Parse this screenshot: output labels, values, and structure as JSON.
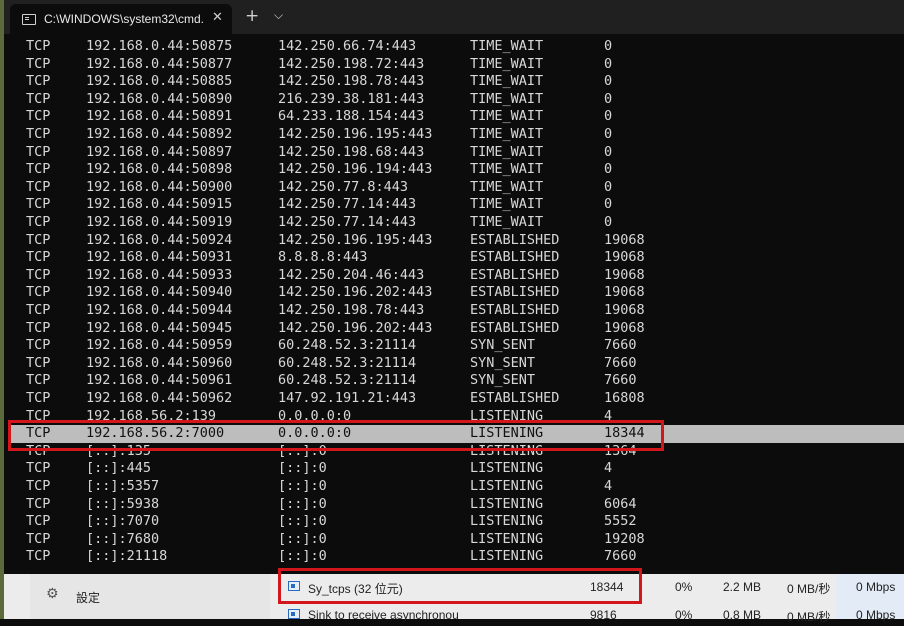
{
  "window": {
    "tab_title": "C:\\WINDOWS\\system32\\cmd.",
    "tab_icon": "terminal-icon",
    "close_glyph": "✕",
    "new_tab_glyph": "+",
    "dropdown_glyph": "⌵"
  },
  "netstat": {
    "rows": [
      {
        "proto": "TCP",
        "local": "192.168.0.44:50875",
        "foreign": "142.250.66.74:443",
        "state": "TIME_WAIT",
        "pid": "0"
      },
      {
        "proto": "TCP",
        "local": "192.168.0.44:50877",
        "foreign": "142.250.198.72:443",
        "state": "TIME_WAIT",
        "pid": "0"
      },
      {
        "proto": "TCP",
        "local": "192.168.0.44:50885",
        "foreign": "142.250.198.78:443",
        "state": "TIME_WAIT",
        "pid": "0"
      },
      {
        "proto": "TCP",
        "local": "192.168.0.44:50890",
        "foreign": "216.239.38.181:443",
        "state": "TIME_WAIT",
        "pid": "0"
      },
      {
        "proto": "TCP",
        "local": "192.168.0.44:50891",
        "foreign": "64.233.188.154:443",
        "state": "TIME_WAIT",
        "pid": "0"
      },
      {
        "proto": "TCP",
        "local": "192.168.0.44:50892",
        "foreign": "142.250.196.195:443",
        "state": "TIME_WAIT",
        "pid": "0"
      },
      {
        "proto": "TCP",
        "local": "192.168.0.44:50897",
        "foreign": "142.250.198.68:443",
        "state": "TIME_WAIT",
        "pid": "0"
      },
      {
        "proto": "TCP",
        "local": "192.168.0.44:50898",
        "foreign": "142.250.196.194:443",
        "state": "TIME_WAIT",
        "pid": "0"
      },
      {
        "proto": "TCP",
        "local": "192.168.0.44:50900",
        "foreign": "142.250.77.8:443",
        "state": "TIME_WAIT",
        "pid": "0"
      },
      {
        "proto": "TCP",
        "local": "192.168.0.44:50915",
        "foreign": "142.250.77.14:443",
        "state": "TIME_WAIT",
        "pid": "0"
      },
      {
        "proto": "TCP",
        "local": "192.168.0.44:50919",
        "foreign": "142.250.77.14:443",
        "state": "TIME_WAIT",
        "pid": "0"
      },
      {
        "proto": "TCP",
        "local": "192.168.0.44:50924",
        "foreign": "142.250.196.195:443",
        "state": "ESTABLISHED",
        "pid": "19068"
      },
      {
        "proto": "TCP",
        "local": "192.168.0.44:50931",
        "foreign": "8.8.8.8:443",
        "state": "ESTABLISHED",
        "pid": "19068"
      },
      {
        "proto": "TCP",
        "local": "192.168.0.44:50933",
        "foreign": "142.250.204.46:443",
        "state": "ESTABLISHED",
        "pid": "19068"
      },
      {
        "proto": "TCP",
        "local": "192.168.0.44:50940",
        "foreign": "142.250.196.202:443",
        "state": "ESTABLISHED",
        "pid": "19068"
      },
      {
        "proto": "TCP",
        "local": "192.168.0.44:50944",
        "foreign": "142.250.198.78:443",
        "state": "ESTABLISHED",
        "pid": "19068"
      },
      {
        "proto": "TCP",
        "local": "192.168.0.44:50945",
        "foreign": "142.250.196.202:443",
        "state": "ESTABLISHED",
        "pid": "19068"
      },
      {
        "proto": "TCP",
        "local": "192.168.0.44:50959",
        "foreign": "60.248.52.3:21114",
        "state": "SYN_SENT",
        "pid": "7660"
      },
      {
        "proto": "TCP",
        "local": "192.168.0.44:50960",
        "foreign": "60.248.52.3:21114",
        "state": "SYN_SENT",
        "pid": "7660"
      },
      {
        "proto": "TCP",
        "local": "192.168.0.44:50961",
        "foreign": "60.248.52.3:21114",
        "state": "SYN_SENT",
        "pid": "7660"
      },
      {
        "proto": "TCP",
        "local": "192.168.0.44:50962",
        "foreign": "147.92.191.21:443",
        "state": "ESTABLISHED",
        "pid": "16808"
      },
      {
        "proto": "TCP",
        "local": "192.168.56.2:139",
        "foreign": "0.0.0.0:0",
        "state": "LISTENING",
        "pid": "4"
      },
      {
        "proto": "TCP",
        "local": "192.168.56.2:7000",
        "foreign": "0.0.0.0:0",
        "state": "LISTENING",
        "pid": "18344",
        "selected": true
      },
      {
        "proto": "TCP",
        "local": "[::]:135",
        "foreign": "[::]:0",
        "state": "LISTENING",
        "pid": "1364"
      },
      {
        "proto": "TCP",
        "local": "[::]:445",
        "foreign": "[::]:0",
        "state": "LISTENING",
        "pid": "4"
      },
      {
        "proto": "TCP",
        "local": "[::]:5357",
        "foreign": "[::]:0",
        "state": "LISTENING",
        "pid": "4"
      },
      {
        "proto": "TCP",
        "local": "[::]:5938",
        "foreign": "[::]:0",
        "state": "LISTENING",
        "pid": "6064"
      },
      {
        "proto": "TCP",
        "local": "[::]:7070",
        "foreign": "[::]:0",
        "state": "LISTENING",
        "pid": "5552"
      },
      {
        "proto": "TCP",
        "local": "[::]:7680",
        "foreign": "[::]:0",
        "state": "LISTENING",
        "pid": "19208"
      },
      {
        "proto": "TCP",
        "local": "[::]:21118",
        "foreign": "[::]:0",
        "state": "LISTENING",
        "pid": "7660"
      }
    ]
  },
  "task_manager": {
    "settings_label": "設定",
    "settings_icon": "gear-icon",
    "processes": [
      {
        "name": "Sy_tcps (32 位元)",
        "pid": "18344",
        "cpu": "0%",
        "memory": "2.2 MB",
        "disk": "0 MB/秒",
        "network": "0 Mbps"
      },
      {
        "name": "Sink to receive asynchronou",
        "pid": "9816",
        "cpu": "0%",
        "memory": "0.8 MB",
        "disk": "0 MB/秒",
        "network": "0 Mbps"
      }
    ]
  },
  "colors": {
    "console_bg": "#0c0c0c",
    "console_text": "#d8d8d8",
    "selection_bg": "#bdbdbd",
    "highlight_red": "#d2161b"
  }
}
